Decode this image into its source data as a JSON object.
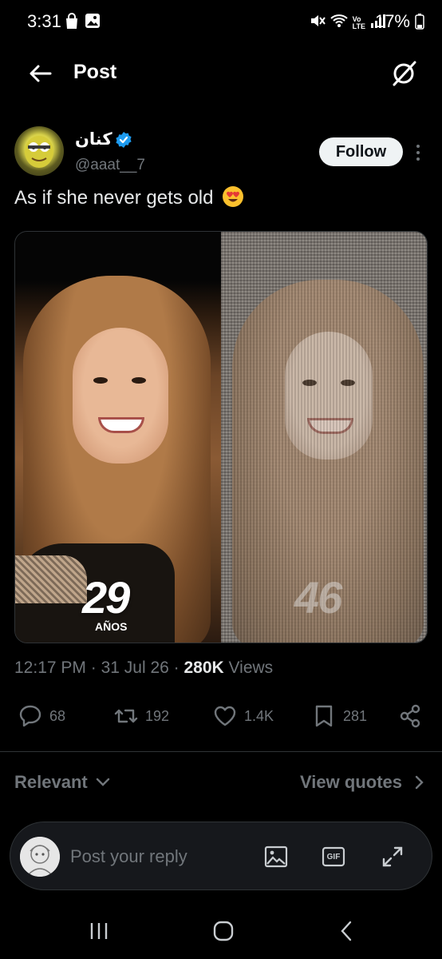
{
  "status_bar": {
    "time": "3:31",
    "battery": "17%",
    "icons_left": [
      "shopping-bag-icon",
      "gallery-icon"
    ],
    "icons_right": [
      "mute-icon",
      "wifi-icon",
      "volte-icon",
      "signal-icon",
      "battery-icon"
    ]
  },
  "header": {
    "title": "Post"
  },
  "post": {
    "author": {
      "display_name": "كنان",
      "handle": "@aaat__7",
      "verified": true
    },
    "follow_label": "Follow",
    "text": "As if she never gets old",
    "emoji": "smiling-face-with-heart-eyes",
    "media": {
      "left_age": "29",
      "left_label": "AÑOS",
      "right_age": "46"
    },
    "meta": {
      "time": "12:17 PM",
      "separator": "·",
      "date": "31 Jul 26",
      "views_count": "280K",
      "views_label": "Views"
    },
    "actions": {
      "replies": "68",
      "reposts": "192",
      "likes": "1.4K",
      "bookmarks": "281"
    }
  },
  "sort": {
    "relevant_label": "Relevant",
    "view_quotes_label": "View quotes"
  },
  "reply": {
    "placeholder": "Post your reply",
    "gif_label": "GIF"
  },
  "colors": {
    "background": "#000000",
    "text_primary": "#e7e9ea",
    "text_secondary": "#71767b",
    "verified": "#1d9bf0",
    "follow_bg": "#eff3f4"
  }
}
